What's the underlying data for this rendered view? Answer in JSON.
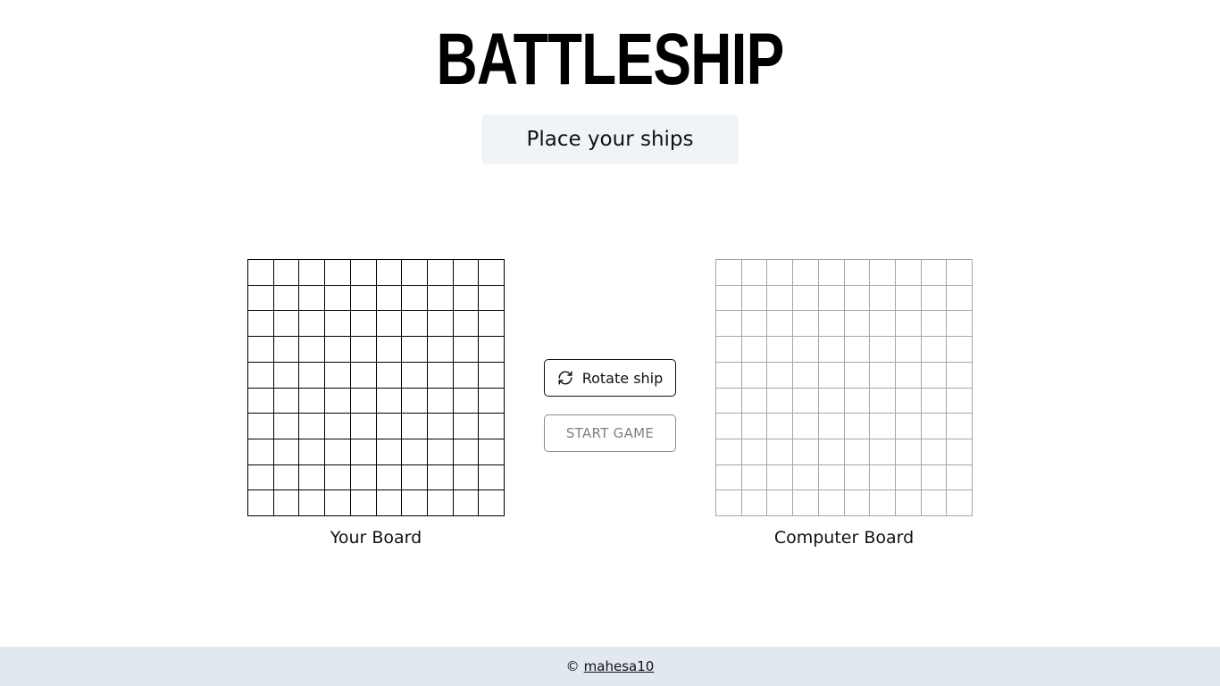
{
  "header": {
    "title": "BATTLESHIP"
  },
  "status": {
    "message": "Place your ships"
  },
  "boards": {
    "player": {
      "label": "Your Board",
      "rows": 10,
      "cols": 10
    },
    "computer": {
      "label": "Computer Board",
      "rows": 10,
      "cols": 10
    }
  },
  "controls": {
    "rotate_label": "Rotate ship",
    "rotate_icon": "refresh-icon",
    "start_label": "START GAME",
    "start_enabled": false
  },
  "footer": {
    "copyright": "©",
    "author": "mahesa10"
  },
  "colors": {
    "status_bg": "#f0f3f7",
    "footer_bg": "#e2e8f0",
    "player_grid": "#000000",
    "computer_grid": "#a6a6a6",
    "disabled_text": "#808080"
  }
}
